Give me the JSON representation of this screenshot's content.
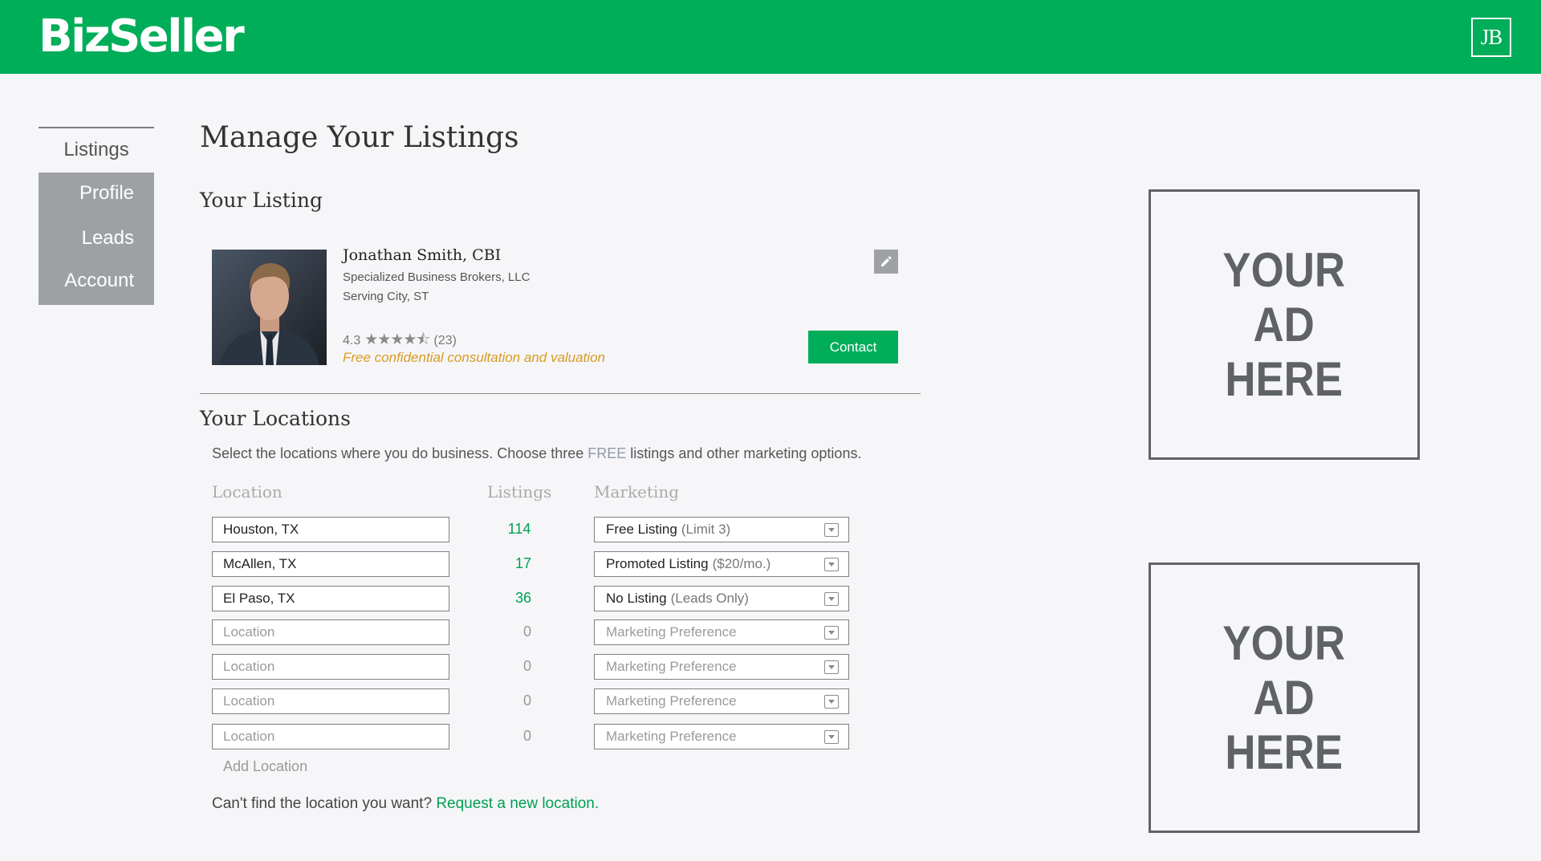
{
  "app": {
    "logo": "BizSeller",
    "user_initials": "JB"
  },
  "sidebar": {
    "items": [
      {
        "label": "Listings",
        "active": true
      },
      {
        "label": "Profile"
      },
      {
        "label": "Leads"
      },
      {
        "label": "Account"
      }
    ]
  },
  "page": {
    "title": "Manage Your Listings"
  },
  "listing": {
    "section_title": "Your Listing",
    "name": "Jonathan Smith, CBI",
    "company": "Specialized Business Brokers, LLC",
    "serving": "Serving City, ST",
    "rating": "4.3",
    "rating_stars": 4.3,
    "review_count": "(23)",
    "promo": "Free confidential consultation and valuation",
    "contact_label": "Contact"
  },
  "locations": {
    "section_title": "Your Locations",
    "desc_before": "Select the locations where you do business. Choose three ",
    "desc_free": "FREE",
    "desc_after": " listings and other marketing options.",
    "headers": {
      "location": "Location",
      "listings": "Listings",
      "marketing": "Marketing"
    },
    "rows": [
      {
        "location": "Houston, TX",
        "count": "114",
        "marketing_main": "Free Listing",
        "marketing_sub": "(Limit 3)"
      },
      {
        "location": "McAllen, TX",
        "count": "17",
        "marketing_main": "Promoted Listing",
        "marketing_sub": "($20/mo.)"
      },
      {
        "location": "El Paso, TX",
        "count": "36",
        "marketing_main": "No Listing",
        "marketing_sub": "(Leads Only)"
      },
      {
        "location": "",
        "count": "0",
        "marketing_main": "Marketing Preference",
        "marketing_sub": ""
      },
      {
        "location": "",
        "count": "0",
        "marketing_main": "Marketing Preference",
        "marketing_sub": ""
      },
      {
        "location": "",
        "count": "0",
        "marketing_main": "Marketing Preference",
        "marketing_sub": ""
      },
      {
        "location": "",
        "count": "0",
        "marketing_main": "Marketing Preference",
        "marketing_sub": ""
      }
    ],
    "location_placeholder": "Location",
    "add_location": "Add Location",
    "cant_find": "Can't find the location you want? ",
    "request_link": "Request a new location",
    "request_period": "."
  },
  "ads": [
    {
      "line1": "YOUR",
      "line2": "AD",
      "line3": "HERE"
    },
    {
      "line1": "YOUR",
      "line2": "AD",
      "line3": "HERE"
    }
  ],
  "colors": {
    "brand": "#00ad59",
    "accent_orange": "#d89a21",
    "sidebar_gray": "#9ea1a4"
  }
}
